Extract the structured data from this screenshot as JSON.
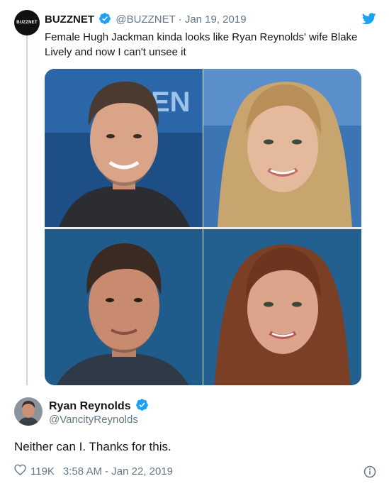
{
  "quoted_tweet": {
    "avatar_text": "BUZZNET",
    "display_name": "BUZZNET",
    "handle": "@BUZZNET",
    "separator": "·",
    "date": "Jan 19, 2019",
    "text": "Female Hugh Jackman kinda looks like Ryan Reynolds' wife Blake Lively and now I can't unsee it",
    "media": [
      {
        "id": "top-left"
      },
      {
        "id": "top-right"
      },
      {
        "id": "bottom-left"
      },
      {
        "id": "bottom-right"
      }
    ]
  },
  "reply_tweet": {
    "display_name": "Ryan Reynolds",
    "handle": "@VancityReynolds",
    "text": "Neither can I. Thanks for this.",
    "likes": "119K",
    "time": "3:58 AM - Jan 22, 2019"
  },
  "icons": {
    "verified": "verified-badge-icon",
    "bird": "twitter-bird-icon",
    "heart": "heart-icon",
    "info": "info-icon"
  },
  "colors": {
    "verified_blue": "#1da1f2",
    "muted_text": "#657786",
    "thread_line": "#ccd6dd"
  }
}
